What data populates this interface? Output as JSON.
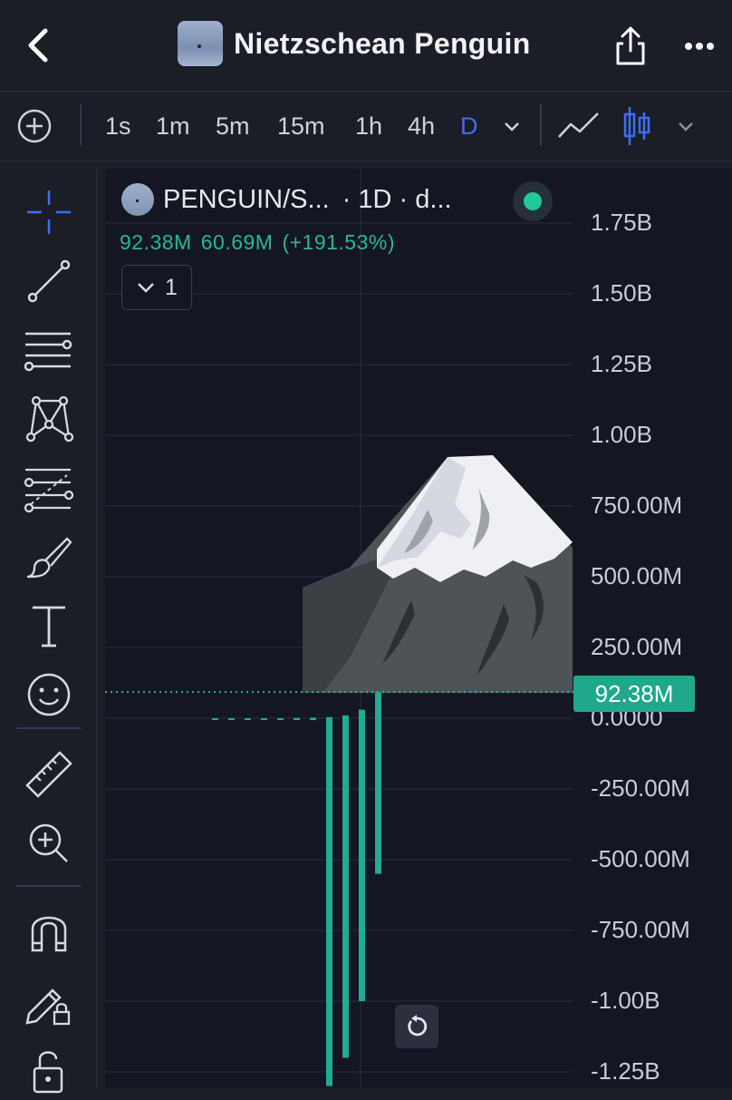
{
  "header": {
    "title": "Nietzschean Penguin",
    "icons": [
      "back-chevron-icon",
      "share-icon",
      "more-icon"
    ]
  },
  "toolbar": {
    "intervals": [
      "1s",
      "1m",
      "5m",
      "15m",
      "1h",
      "4h",
      "D"
    ],
    "active_interval": "D"
  },
  "sidebar": {
    "tools": [
      "crosshair-icon",
      "trendline-icon",
      "horizontal-lines-icon",
      "pattern-icon",
      "fib-icon",
      "brush-icon",
      "text-icon",
      "emoji-icon",
      "ruler-icon",
      "zoom-in-icon",
      "magnet-icon",
      "lock-drawings-icon",
      "unlock-icon"
    ]
  },
  "legend": {
    "symbol": "PENGUIN/S...",
    "meta": "· 1D · d...",
    "last": "92.38M",
    "change": "60.69M",
    "change_pct": "(+191.53%)",
    "indicators_count": "1"
  },
  "colors": {
    "up": "#22ab94",
    "background": "#141722",
    "accent": "#3d6ef5"
  },
  "chart_data": {
    "type": "bar",
    "ylim": [
      -1350000000,
      1900000000
    ],
    "y_ticks": [
      "1.75B",
      "1.50B",
      "1.25B",
      "1.00B",
      "750.00M",
      "500.00M",
      "250.00M",
      "0.0000",
      "-250.00M",
      "-500.00M",
      "-750.00M",
      "-1.00B",
      "-1.25B"
    ],
    "last_price_label": "92.38M",
    "last_price": 92380000,
    "series": [
      {
        "values": [
          0,
          0,
          0,
          0,
          0,
          1000000,
          2000000,
          4000000,
          10000000,
          30000000,
          92380000
        ]
      },
      {
        "values": [
          0,
          0,
          0,
          0,
          0,
          0,
          0,
          -1300000000,
          -1200000000,
          -1000000000,
          -550000000
        ]
      }
    ]
  }
}
